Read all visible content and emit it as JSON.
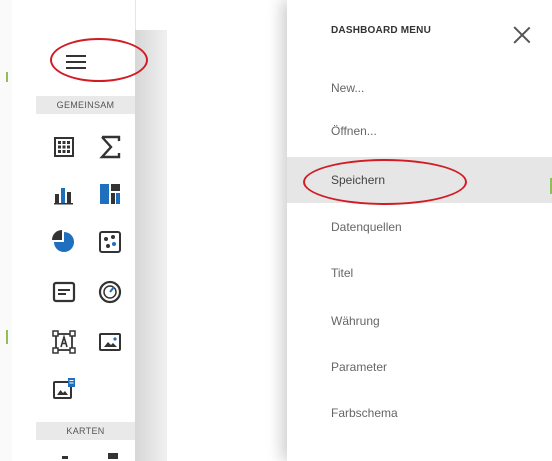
{
  "toolbox": {
    "sections": [
      {
        "label": "GEMEINSAM"
      },
      {
        "label": "KARTEN"
      }
    ],
    "icons": [
      "grid-icon",
      "pivot-sum-icon",
      "chart-icon",
      "treemap-icon",
      "pie-icon",
      "scatter-icon",
      "card-icon",
      "gauge-icon",
      "text-box-icon",
      "image-icon",
      "bound-image-icon"
    ]
  },
  "menu": {
    "title": "DASHBOARD MENU",
    "items": [
      {
        "label": "New..."
      },
      {
        "label": "Öffnen..."
      },
      {
        "label": "Speichern",
        "selected": true
      },
      {
        "label": "Datenquellen"
      },
      {
        "label": "Titel"
      },
      {
        "label": "Währung"
      },
      {
        "label": "Parameter"
      },
      {
        "label": "Farbschema"
      }
    ]
  },
  "colors": {
    "accent_blue": "#1f6fbf",
    "highlight_red": "#d11c24",
    "selected_bg": "#e6e6e6",
    "icon_dark": "#333333"
  }
}
